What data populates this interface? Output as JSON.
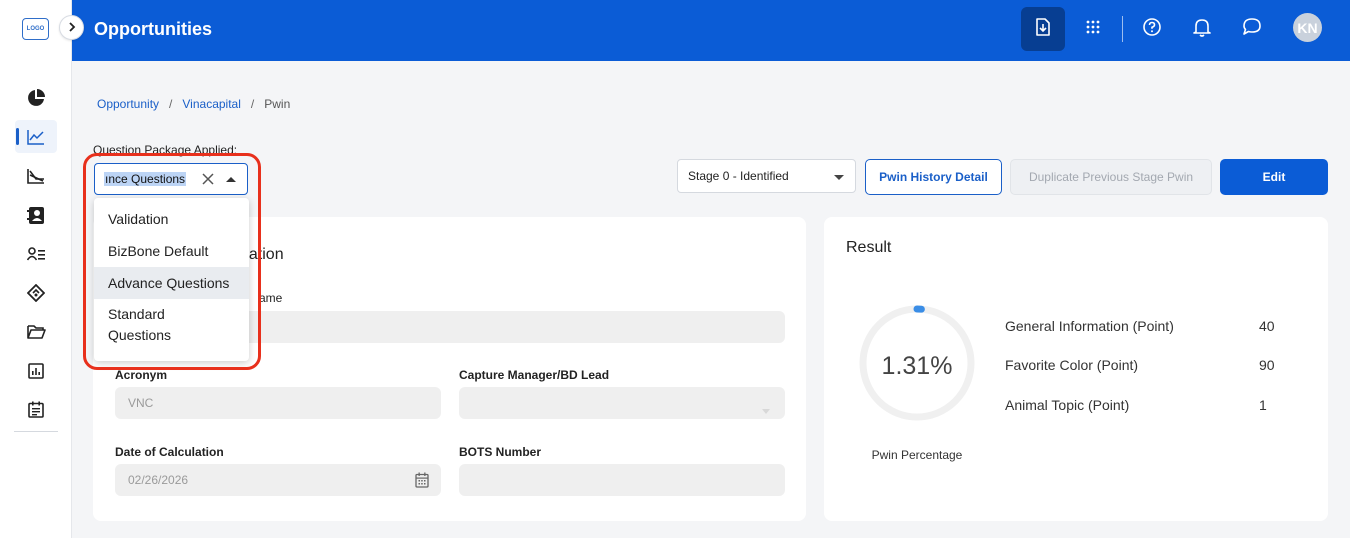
{
  "app": {
    "logo_text": "LOGO",
    "page_title": "Opportunities",
    "avatar_initials": "KN",
    "brand_color": "#0b5cd6"
  },
  "header": {
    "icons": [
      "download-icon",
      "apps-grid-icon",
      "help-icon",
      "bell-icon",
      "chat-icon"
    ]
  },
  "sidebar": {
    "items": [
      {
        "name": "dashboard-pie-icon"
      },
      {
        "name": "opportunities-trend-icon",
        "active": true
      },
      {
        "name": "pipeline-chart-icon"
      },
      {
        "name": "contacts-book-icon"
      },
      {
        "name": "users-list-icon"
      },
      {
        "name": "deals-tag-icon"
      },
      {
        "name": "folder-icon"
      },
      {
        "name": "reports-icon"
      },
      {
        "name": "calendar-list-icon"
      }
    ]
  },
  "breadcrumb": {
    "items": [
      "Opportunity",
      "Vinacapital",
      "Pwin"
    ],
    "separator": "/"
  },
  "question_package": {
    "label": "Question Package Applied:",
    "value": "ınce Questions",
    "options": [
      "Validation",
      "BizBone Default",
      "Advance Questions",
      "Standard Questions"
    ],
    "selected_index": 2
  },
  "toolbar": {
    "stage_value": "Stage 0 - Identified",
    "history_label": "Pwin History Detail",
    "duplicate_label": "Duplicate Previous Stage Pwin",
    "edit_label": "Edit"
  },
  "general": {
    "title": "nation",
    "name_label": "ame",
    "acronym_label": "Acronym",
    "acronym_value": "VNC",
    "capture_label": "Capture Manager/BD Lead",
    "date_label": "Date of Calculation",
    "date_value": "02/26/2026",
    "bots_label": "BOTS Number"
  },
  "result": {
    "title": "Result",
    "percentage_text": "1.31%",
    "percentage_value": 1.31,
    "percentage_label": "Pwin Percentage",
    "metrics": [
      {
        "name": "General Information (Point)",
        "value": "40"
      },
      {
        "name": "Favorite Color (Point)",
        "value": "90"
      },
      {
        "name": "Animal Topic (Point)",
        "value": "1"
      }
    ]
  }
}
